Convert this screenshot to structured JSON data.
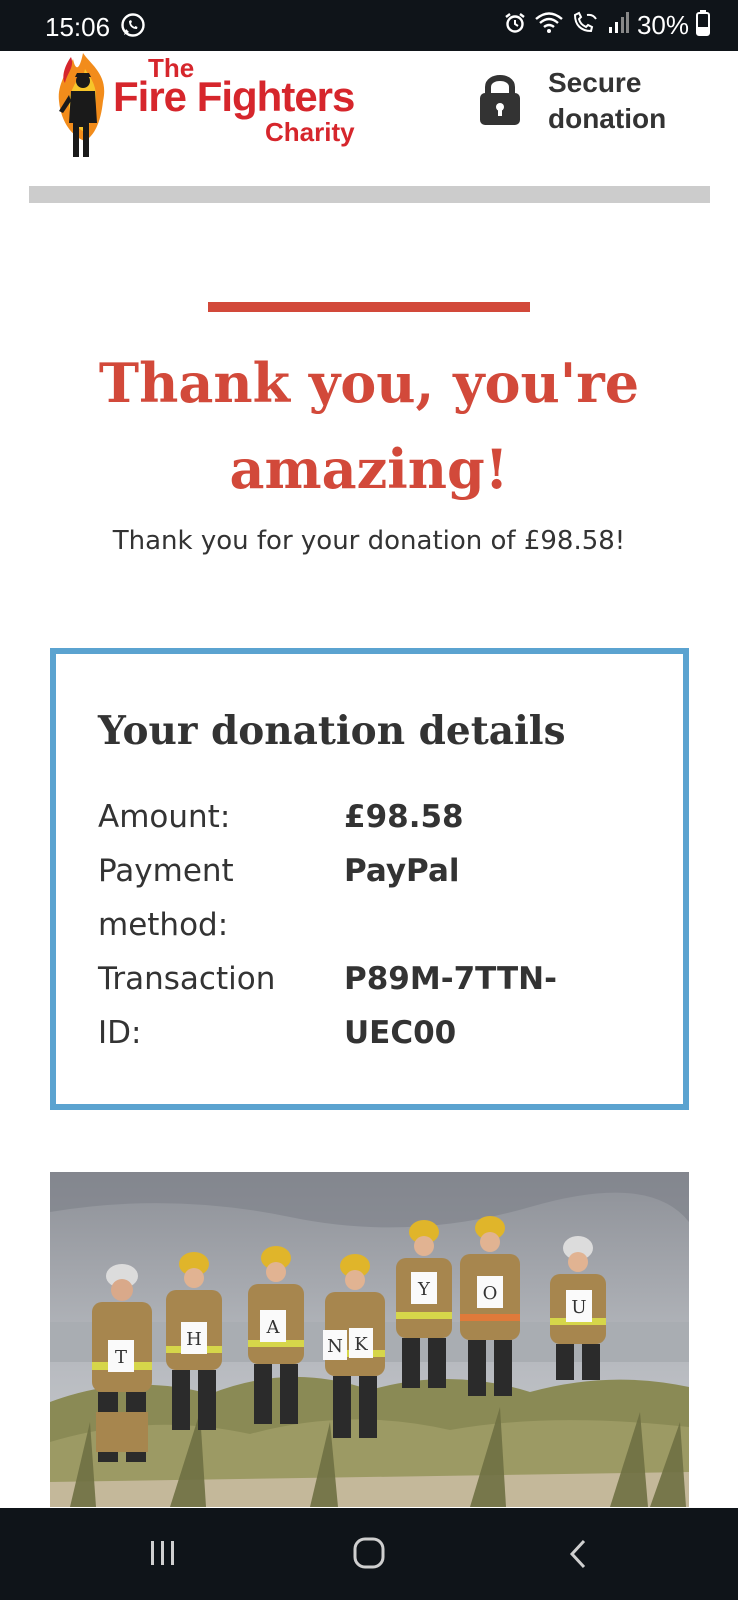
{
  "status_bar": {
    "time": "15:06",
    "battery": "30%",
    "icons": [
      "whatsapp-icon",
      "alarm-icon",
      "wifi-icon",
      "wifi-calling-icon",
      "signal-icon",
      "battery-icon"
    ]
  },
  "header": {
    "logo_the": "The",
    "logo_fire_fighters": "Fire Fighters",
    "logo_charity": "Charity",
    "secure_line1": "Secure",
    "secure_line2": "donation"
  },
  "thank_you": {
    "heading_line1": "Thank you, you're",
    "heading_line2": "amazing!",
    "subtext": "Thank you for your donation of £98.58!"
  },
  "details": {
    "title": "Your donation details",
    "amount_label": "Amount:",
    "amount_value": "£98.58",
    "payment_label_line1": "Payment",
    "payment_label_line2": "method:",
    "payment_value": "PayPal",
    "transaction_label_line1": "Transaction",
    "transaction_label_line2": "ID:",
    "transaction_value_line1": "P89M-7TTN-",
    "transaction_value_line2": "UEC00"
  },
  "photo": {
    "letters": [
      "T",
      "H",
      "A",
      "N",
      "K",
      "Y",
      "O",
      "U"
    ]
  },
  "colors": {
    "brand_red": "#d6262c",
    "heading_red": "#d2493a",
    "box_border_blue": "#5ba3d0",
    "text_dark": "#333333",
    "system_bar": "#0f1419"
  }
}
